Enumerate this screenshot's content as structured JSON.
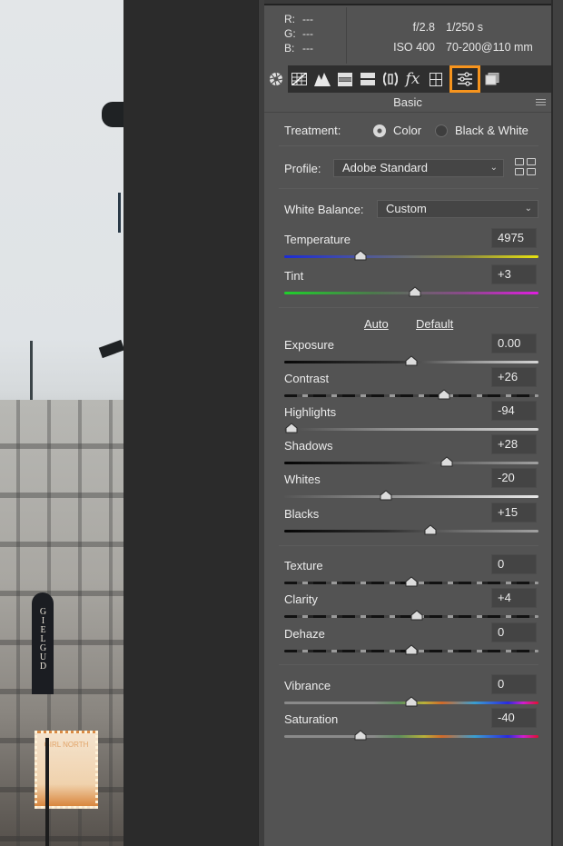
{
  "photo": {
    "sign_text": "GIELGUD",
    "marquee_text": "GIRL NORTH"
  },
  "info": {
    "rgb": [
      {
        "label": "R:",
        "value": "---"
      },
      {
        "label": "G:",
        "value": "---"
      },
      {
        "label": "B:",
        "value": "---"
      }
    ],
    "aperture": "f/2.8",
    "shutter": "1/250 s",
    "iso": "ISO 400",
    "lens": "70-200@110 mm"
  },
  "tabs": [
    {
      "name": "aperture-icon",
      "label": "Basic (camera)"
    },
    {
      "name": "tone-curve-icon",
      "label": "Tone Curve"
    },
    {
      "name": "detail-icon",
      "label": "Detail"
    },
    {
      "name": "hsl-icon",
      "label": "HSL"
    },
    {
      "name": "split-toning-icon",
      "label": "Split Toning"
    },
    {
      "name": "lens-corrections-icon",
      "label": "Lens Corrections"
    },
    {
      "name": "fx-icon",
      "label": "fx"
    },
    {
      "name": "calibration-icon",
      "label": "Calibration"
    },
    {
      "name": "sliders-icon",
      "label": "Basic",
      "active": true
    },
    {
      "name": "presets-icon",
      "label": "Presets"
    }
  ],
  "section": {
    "title": "Basic"
  },
  "treatment": {
    "label": "Treatment:",
    "options": [
      "Color",
      "Black & White"
    ],
    "selected": "Color"
  },
  "profile": {
    "label": "Profile:",
    "value": "Adobe Standard"
  },
  "white_balance": {
    "label": "White Balance:",
    "value": "Custom"
  },
  "links": {
    "auto": "Auto",
    "default": "Default"
  },
  "sliders": {
    "temperature": {
      "label": "Temperature",
      "value": "4975",
      "position": 0.3
    },
    "tint": {
      "label": "Tint",
      "value": "+3",
      "position": 0.515
    },
    "exposure": {
      "label": "Exposure",
      "value": "0.00",
      "position": 0.5
    },
    "contrast": {
      "label": "Contrast",
      "value": "+26",
      "position": 0.63
    },
    "highlights": {
      "label": "Highlights",
      "value": "-94",
      "position": 0.03
    },
    "shadows": {
      "label": "Shadows",
      "value": "+28",
      "position": 0.64
    },
    "whites": {
      "label": "Whites",
      "value": "-20",
      "position": 0.4
    },
    "blacks": {
      "label": "Blacks",
      "value": "+15",
      "position": 0.575
    },
    "texture": {
      "label": "Texture",
      "value": "0",
      "position": 0.5
    },
    "clarity": {
      "label": "Clarity",
      "value": "+4",
      "position": 0.52
    },
    "dehaze": {
      "label": "Dehaze",
      "value": "0",
      "position": 0.5
    },
    "vibrance": {
      "label": "Vibrance",
      "value": "0",
      "position": 0.5
    },
    "saturation": {
      "label": "Saturation",
      "value": "-40",
      "position": 0.3
    }
  },
  "colors": {
    "active_tab_outline": "#f7941d",
    "panel_bg": "#535353",
    "dark_bg": "#2b2b2b"
  }
}
